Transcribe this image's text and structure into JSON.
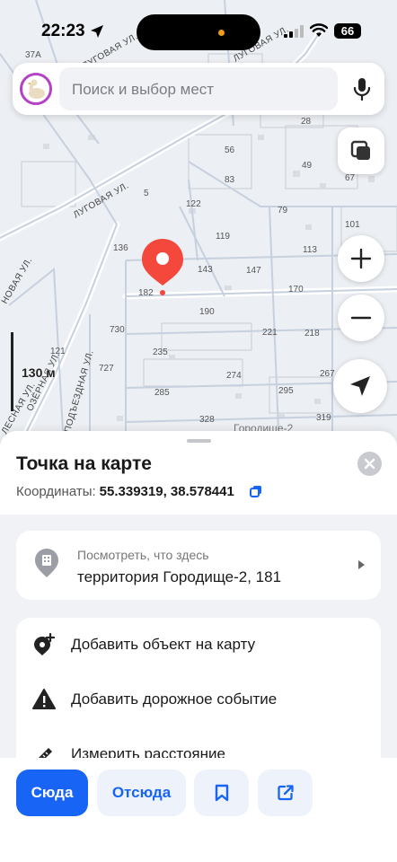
{
  "status_bar": {
    "time": "22:23",
    "battery": "66"
  },
  "search": {
    "placeholder": "Поиск и выбор мест"
  },
  "map": {
    "scale": "130 м",
    "streets": [
      "ЛУГОВАЯ УЛ.",
      "ЛУГОВАЯ УЛ.",
      "ЛУГОВАЯ УЛ.",
      "НОВАЯ УЛ.",
      "ОЗЁРНАЯ УЛ.",
      "ПОДЪЕЗДНАЯ УЛ.",
      "ЛЕСНАЯ УЛ."
    ],
    "labels": [
      "37А",
      "28",
      "56",
      "49",
      "83",
      "67",
      "5",
      "122",
      "79",
      "101",
      "119",
      "113",
      "136",
      "143",
      "147",
      "182",
      "170",
      "190",
      "730",
      "221",
      "218",
      "121",
      "235",
      "727",
      "274",
      "267",
      "295",
      "285",
      "328",
      "319",
      "Городище-2"
    ]
  },
  "sheet": {
    "title": "Точка на карте",
    "coords_label": "Координаты:",
    "coords_value": "55.339319, 38.578441",
    "place": {
      "subtitle": "Посмотреть, что здесь",
      "name": "территория Городище-2, 181"
    },
    "actions": [
      {
        "label": "Добавить объект на карту",
        "icon": "add-place-icon"
      },
      {
        "label": "Добавить дорожное событие",
        "icon": "warning-icon"
      },
      {
        "label": "Измерить расстояние",
        "icon": "ruler-icon"
      }
    ]
  },
  "bottom_bar": {
    "here": "Сюда",
    "from": "Отсюда",
    "bookmark_icon": "bookmark-icon",
    "share_icon": "share-icon"
  },
  "colors": {
    "accent": "#1764f5",
    "pin": "#f4483c",
    "avatar_ring": "#b442c5"
  }
}
